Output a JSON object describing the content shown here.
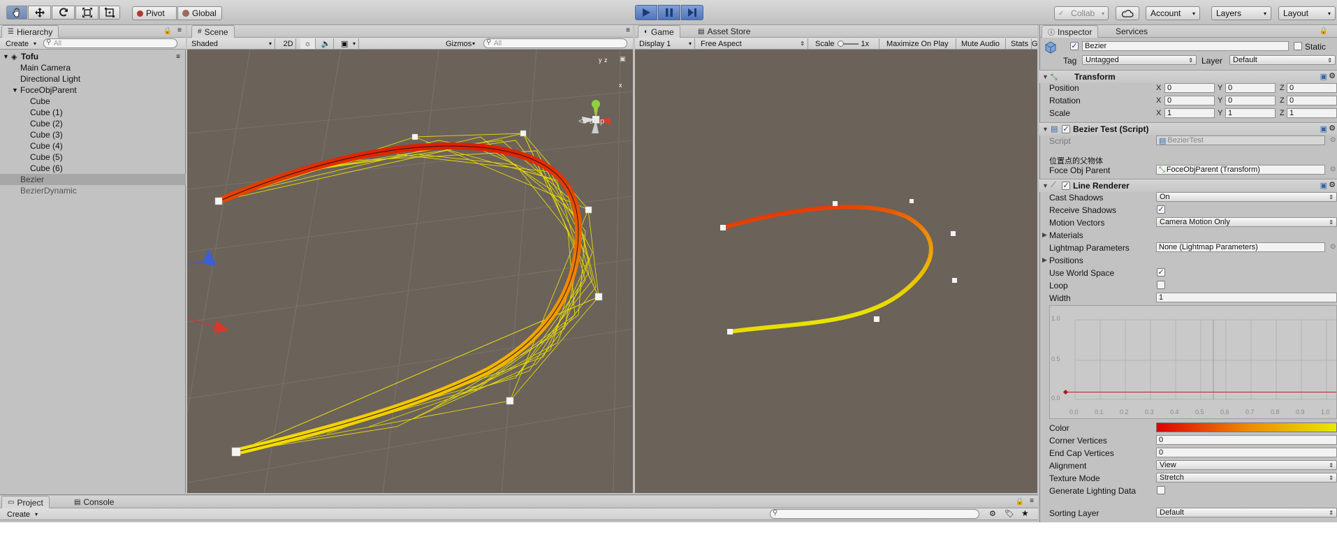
{
  "toolbar": {
    "pivot_label": "Pivot",
    "global_label": "Global",
    "collab_label": "Collab",
    "account_label": "Account",
    "layers_label": "Layers",
    "layout_label": "Layout",
    "tools": [
      "hand-tool",
      "move-tool",
      "rotate-tool",
      "scale-tool",
      "rect-tool"
    ]
  },
  "hierarchy": {
    "tab_label": "Hierarchy",
    "create_label": "Create",
    "search_placeholder": "All",
    "scene_name": "Tofu",
    "items": [
      {
        "label": "Main Camera"
      },
      {
        "label": "Directional Light"
      },
      {
        "label": "FoceObjParent"
      },
      {
        "label": "Cube"
      },
      {
        "label": "Cube (1)"
      },
      {
        "label": "Cube (2)"
      },
      {
        "label": "Cube (3)"
      },
      {
        "label": "Cube (4)"
      },
      {
        "label": "Cube (5)"
      },
      {
        "label": "Cube (6)"
      },
      {
        "label": "Bezier"
      },
      {
        "label": "BezierDynamic"
      }
    ]
  },
  "scene": {
    "tab_label": "Scene",
    "shading_mode": "Shaded",
    "mode_2d": "2D",
    "gizmos_label": "Gizmos",
    "search_placeholder": "All",
    "persp_label": "Persp",
    "gizmo_y": "y",
    "gizmo_z": "z",
    "gizmo_x": "x"
  },
  "game": {
    "tab_label": "Game",
    "asset_store_label": "Asset Store",
    "display": "Display 1",
    "aspect": "Free Aspect",
    "scale_label": "Scale",
    "scale_value": "1x",
    "maximize_label": "Maximize On Play",
    "mute_label": "Mute Audio",
    "stats_label": "Stats",
    "gizmos_short": "G"
  },
  "inspector": {
    "tab_label": "Inspector",
    "services_label": "Services",
    "object_name": "Bezier",
    "static_label": "Static",
    "tag_label": "Tag",
    "tag_value": "Untagged",
    "layer_label": "Layer",
    "layer_value": "Default",
    "transform": {
      "title": "Transform",
      "position_label": "Position",
      "rotation_label": "Rotation",
      "scale_label": "Scale",
      "position": {
        "x": "0",
        "y": "0",
        "z": "0"
      },
      "rotation": {
        "x": "0",
        "y": "0",
        "z": "0"
      },
      "scale": {
        "x": "1",
        "y": "1",
        "z": "1"
      }
    },
    "axis_x": "X",
    "axis_y": "Y",
    "axis_z": "Z",
    "bezier_script": {
      "title": "Bezier Test (Script)",
      "script_label": "Script",
      "script_value": "BezierTest",
      "header_note": "位置点的父物体",
      "parent_label": "Foce Obj Parent",
      "parent_value": "FoceObjParent (Transform)"
    },
    "line_renderer": {
      "title": "Line Renderer",
      "cast_shadows_label": "Cast Shadows",
      "cast_shadows_value": "On",
      "receive_shadows_label": "Receive Shadows",
      "receive_shadows": true,
      "motion_vectors_label": "Motion Vectors",
      "motion_vectors_value": "Camera Motion Only",
      "materials_label": "Materials",
      "lightmap_label": "Lightmap Parameters",
      "lightmap_value": "None (Lightmap Parameters)",
      "positions_label": "Positions",
      "use_world_space_label": "Use World Space",
      "use_world_space": true,
      "loop_label": "Loop",
      "loop": false,
      "width_label": "Width",
      "width_value": "1",
      "curve_y_ticks": [
        "1.0",
        "0.5",
        "0.0"
      ],
      "curve_x_ticks": [
        "0.0",
        "0.1",
        "0.2",
        "0.3",
        "0.4",
        "0.5",
        "0.6",
        "0.7",
        "0.8",
        "0.9",
        "1.0"
      ],
      "curve_value": 0.1,
      "color_label": "Color",
      "gradient_start": "#e00000",
      "gradient_mid": "#ee8800",
      "gradient_end": "#e8e800",
      "corner_vertices_label": "Corner Vertices",
      "corner_vertices_value": "0",
      "end_cap_label": "End Cap Vertices",
      "end_cap_value": "0",
      "alignment_label": "Alignment",
      "alignment_value": "View",
      "texture_mode_label": "Texture Mode",
      "texture_mode_value": "Stretch",
      "gen_lighting_label": "Generate Lighting Data",
      "gen_lighting": false,
      "sorting_layer_label": "Sorting Layer",
      "sorting_layer_value": "Default"
    }
  },
  "project": {
    "tab_label": "Project",
    "console_label": "Console",
    "create_label": "Create"
  },
  "colors": {
    "viewport_bg": "#6b625a",
    "selection": "#a7a7a7",
    "play_blue": "#4f74b8"
  }
}
